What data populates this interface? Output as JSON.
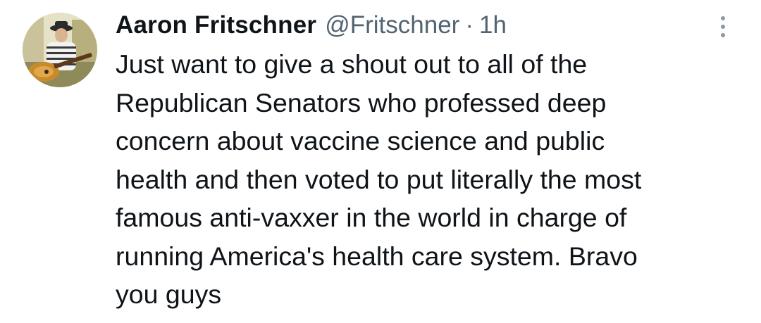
{
  "tweet": {
    "author": {
      "display_name": "Aaron Fritschner",
      "handle": "@Fritschner",
      "avatar_icon": "profile-photo-guitarist"
    },
    "separator": "·",
    "time": "1h",
    "more_icon": "more-vertical-icon",
    "text_lines": [
      "Just want to give a shout out to all of the",
      "Republican Senators who professed deep",
      "concern about vaccine science and public",
      "health and then voted to put literally the most",
      "famous anti-vaxxer in the world in charge of",
      "running America's health care system. Bravo",
      "you guys"
    ]
  },
  "colors": {
    "text_primary": "#0f1419",
    "text_secondary": "#536471",
    "background": "#ffffff"
  }
}
